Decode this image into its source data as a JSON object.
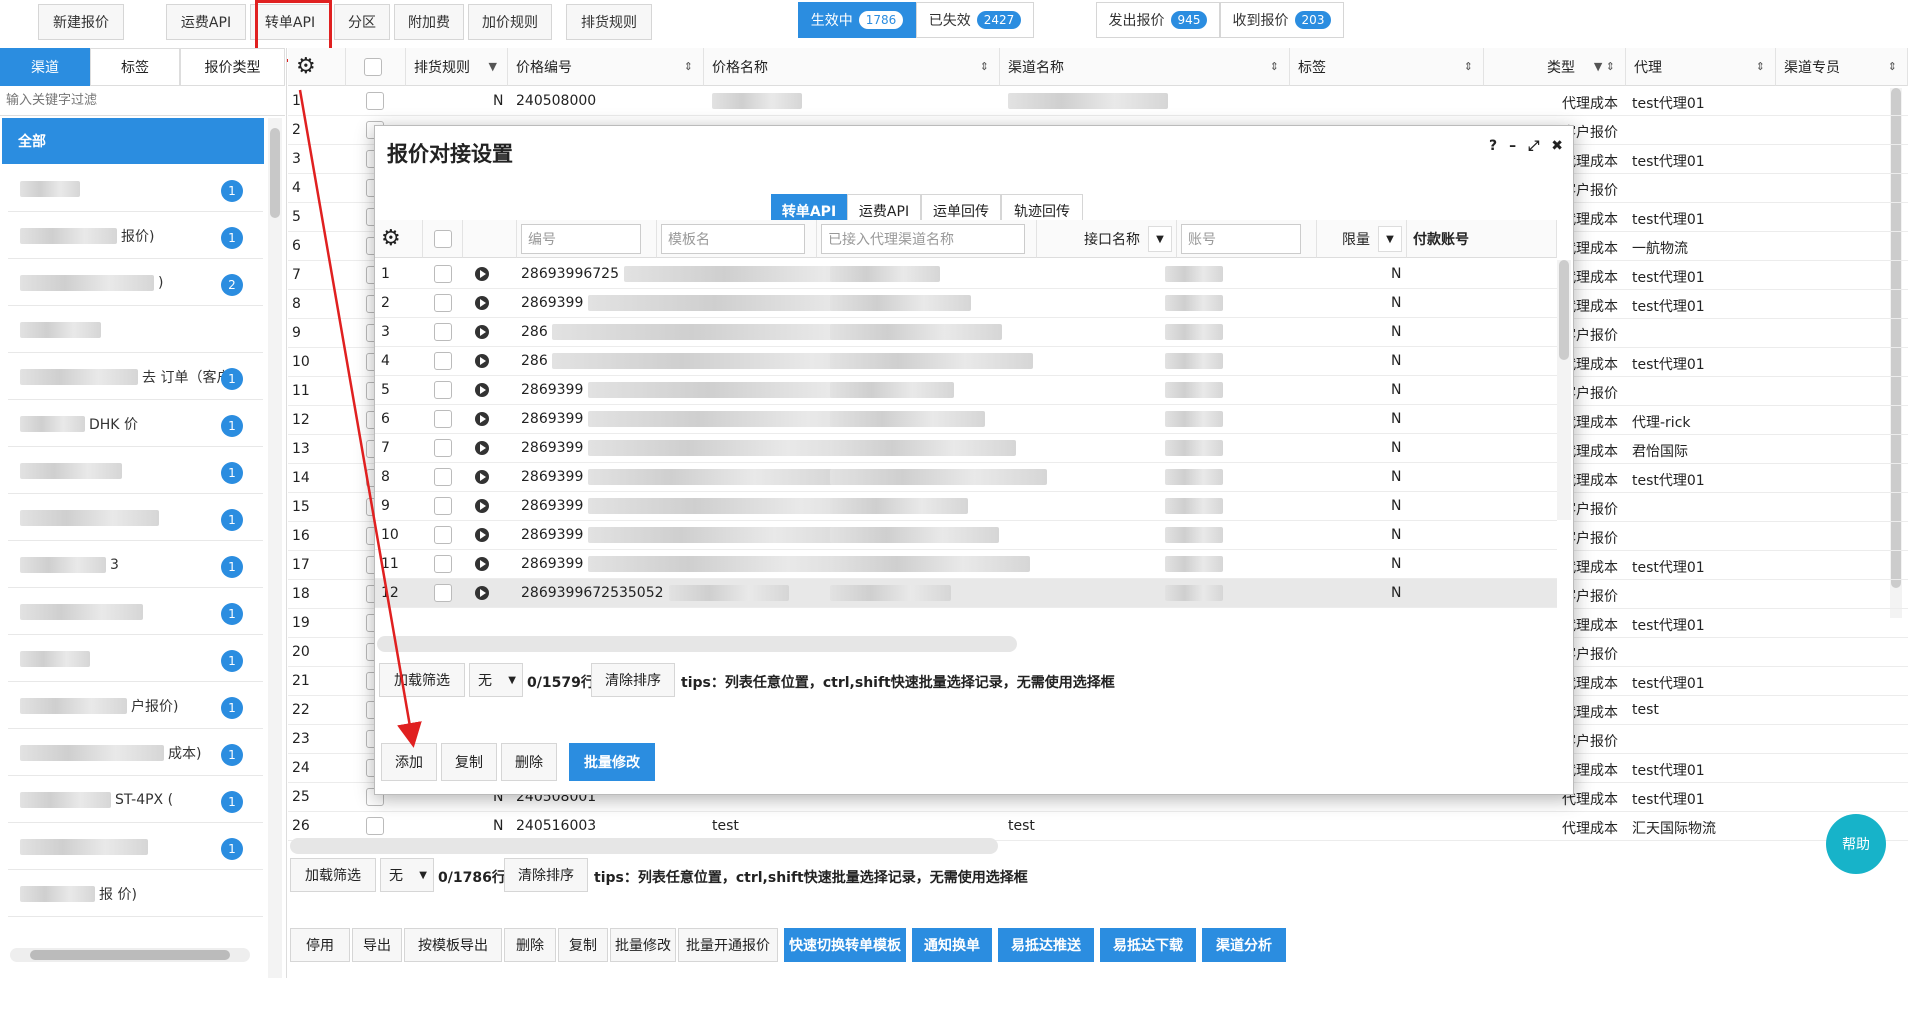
{
  "toolbar": {
    "new_quote": "新建报价",
    "freight_api": "运费API",
    "transfer_api": "转单API",
    "zone": "分区",
    "surcharge": "附加费",
    "markup_rules": "加价规则",
    "sort_rules": "排货规则",
    "status_active": "生效中",
    "status_active_count": "1786",
    "status_expired": "已失效",
    "status_expired_count": "2427",
    "sent_quotes": "发出报价",
    "sent_count": "945",
    "recv_quotes": "收到报价",
    "recv_count": "203"
  },
  "left": {
    "tabs": [
      "渠道",
      "标签",
      "报价类型"
    ],
    "filter_placeholder": "输入关键字过滤",
    "all": "全部",
    "items": [
      {
        "text": "",
        "badge": "1"
      },
      {
        "text": "报价)",
        "badge": "1"
      },
      {
        "text": ")",
        "badge": "2"
      },
      {
        "text": "",
        "badge": ""
      },
      {
        "text": "去 订单（客户",
        "badge": "1"
      },
      {
        "text": "DHK 价",
        "badge": "1"
      },
      {
        "text": "",
        "badge": "1"
      },
      {
        "text": "",
        "badge": "1"
      },
      {
        "text": "3",
        "badge": "1"
      },
      {
        "text": "",
        "badge": "1"
      },
      {
        "text": "",
        "badge": "1"
      },
      {
        "text": "户报价)",
        "badge": "1"
      },
      {
        "text": "成本)",
        "badge": "1"
      },
      {
        "text": "ST-4PX (",
        "badge": "1"
      },
      {
        "text": "",
        "badge": "1"
      },
      {
        "text": "报 价)",
        "badge": ""
      }
    ]
  },
  "grid": {
    "headers": [
      "排货规则",
      "价格编号",
      "价格名称",
      "渠道名称",
      "标签",
      "类型",
      "代理",
      "渠道专员"
    ],
    "rows": [
      {
        "n": "1",
        "flag": "N",
        "code": "240508000",
        "type": "代理成本",
        "agent": "test代理01"
      },
      {
        "n": "2",
        "flag": "",
        "code": "",
        "type": "客户报价",
        "agent": ""
      },
      {
        "n": "3",
        "flag": "",
        "code": "",
        "type": "代理成本",
        "agent": "test代理01"
      },
      {
        "n": "4",
        "flag": "",
        "code": "",
        "type": "客户报价",
        "agent": ""
      },
      {
        "n": "5",
        "flag": "",
        "code": "",
        "type": "代理成本",
        "agent": "test代理01"
      },
      {
        "n": "6",
        "flag": "",
        "code": "",
        "type": "代理成本",
        "agent": "一航物流"
      },
      {
        "n": "7",
        "flag": "",
        "code": "",
        "type": "代理成本",
        "agent": "test代理01"
      },
      {
        "n": "8",
        "flag": "",
        "code": "",
        "type": "代理成本",
        "agent": "test代理01"
      },
      {
        "n": "9",
        "flag": "",
        "code": "",
        "type": "客户报价",
        "agent": ""
      },
      {
        "n": "10",
        "flag": "",
        "code": "",
        "type": "代理成本",
        "agent": "test代理01"
      },
      {
        "n": "11",
        "flag": "",
        "code": "",
        "type": "客户报价",
        "agent": ""
      },
      {
        "n": "12",
        "flag": "",
        "code": "",
        "type": "代理成本",
        "agent": "代理-rick"
      },
      {
        "n": "13",
        "flag": "",
        "code": "",
        "type": "代理成本",
        "agent": "君怡国际"
      },
      {
        "n": "14",
        "flag": "",
        "code": "",
        "type": "代理成本",
        "agent": "test代理01"
      },
      {
        "n": "15",
        "flag": "",
        "code": "",
        "type": "客户报价",
        "agent": ""
      },
      {
        "n": "16",
        "flag": "",
        "code": "",
        "type": "客户报价",
        "agent": ""
      },
      {
        "n": "17",
        "flag": "",
        "code": "",
        "type": "代理成本",
        "agent": "test代理01"
      },
      {
        "n": "18",
        "flag": "",
        "code": "",
        "type": "客户报价",
        "agent": ""
      },
      {
        "n": "19",
        "flag": "",
        "code": "",
        "type": "代理成本",
        "agent": "test代理01"
      },
      {
        "n": "20",
        "flag": "",
        "code": "",
        "type": "客户报价",
        "agent": ""
      },
      {
        "n": "21",
        "flag": "",
        "code": "",
        "type": "代理成本",
        "agent": "test代理01"
      },
      {
        "n": "22",
        "flag": "",
        "code": "",
        "type": "代理成本",
        "agent": "test"
      },
      {
        "n": "23",
        "flag": "",
        "code": "",
        "type": "客户报价",
        "agent": ""
      },
      {
        "n": "24",
        "flag": "",
        "code": "",
        "type": "代理成本",
        "agent": "test代理01"
      },
      {
        "n": "25",
        "flag": "N",
        "code": "240508001",
        "type": "代理成本",
        "agent": "test代理01"
      },
      {
        "n": "26",
        "flag": "N",
        "code": "240516003",
        "name": "test",
        "channel": "test",
        "type": "代理成本",
        "agent": "汇天国际物流"
      }
    ],
    "footer": {
      "load_filter": "加载筛选",
      "none": "无",
      "count": "0/1786行",
      "clear_sort": "清除排序",
      "tips": "tips：列表任意位置，ctrl,shift快速批量选择记录，无需使用选择框"
    }
  },
  "bottom": {
    "buttons": [
      "停用",
      "导出",
      "按模板导出",
      "删除",
      "复制",
      "批量修改",
      "批量开通报价"
    ],
    "blue_buttons": [
      "快速切换转单模板",
      "通知换单",
      "易抵达推送",
      "易抵达下载",
      "渠道分析"
    ],
    "help": "帮助"
  },
  "dialog": {
    "title": "报价对接设置",
    "ctrl": {
      "help": "?",
      "min": "–",
      "max": "⤢",
      "close": "✖"
    },
    "tabs": [
      "转单API",
      "运费API",
      "运单回传",
      "轨迹回传"
    ],
    "headers": {
      "code_placeholder": "编号",
      "template_placeholder": "模板名",
      "channel_placeholder": "已接入代理渠道名称",
      "interface": "接口名称",
      "account_placeholder": "账号",
      "limit": "限量",
      "pay_account": "付款账号"
    },
    "rows": [
      {
        "n": "1",
        "code": "28693996725",
        "limit": "N"
      },
      {
        "n": "2",
        "code": "2869399",
        "limit": "N"
      },
      {
        "n": "3",
        "code": "286",
        "limit": "N"
      },
      {
        "n": "4",
        "code": "286",
        "limit": "N"
      },
      {
        "n": "5",
        "code": "2869399",
        "limit": "N"
      },
      {
        "n": "6",
        "code": "2869399",
        "limit": "N"
      },
      {
        "n": "7",
        "code": "2869399",
        "limit": "N"
      },
      {
        "n": "8",
        "code": "2869399",
        "limit": "N"
      },
      {
        "n": "9",
        "code": "2869399",
        "limit": "N"
      },
      {
        "n": "10",
        "code": "2869399",
        "limit": "N"
      },
      {
        "n": "11",
        "code": "2869399",
        "limit": "N"
      },
      {
        "n": "12",
        "code": "2869399672535052",
        "limit": "N"
      }
    ],
    "footer": {
      "load_filter": "加载筛选",
      "none": "无",
      "count": "0/1579行",
      "clear_sort": "清除排序",
      "tips": "tips：列表任意位置，ctrl,shift快速批量选择记录，无需使用选择框"
    },
    "buttons": {
      "add": "添加",
      "copy": "复制",
      "delete": "删除",
      "batch_edit": "批量修改"
    }
  },
  "colors": {
    "accent": "#2b8de0",
    "annotation": "#e02020",
    "help": "#17b3c9"
  }
}
